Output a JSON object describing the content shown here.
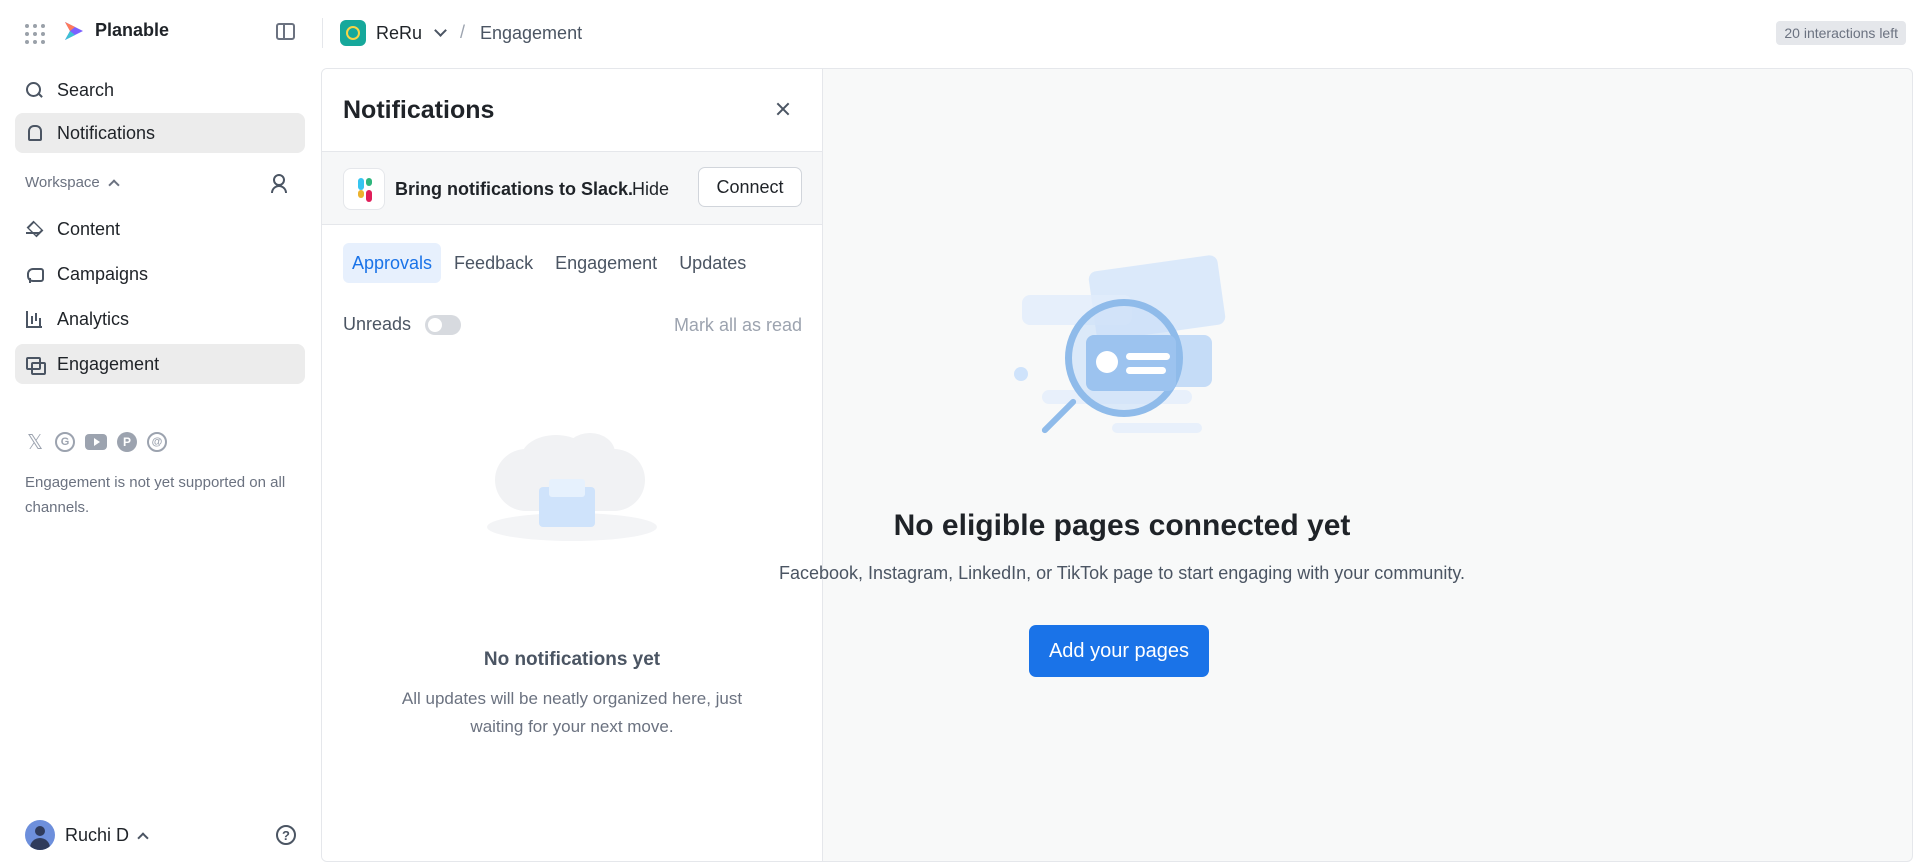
{
  "app": {
    "name": "Planable",
    "workspace_name": "ReRu",
    "breadcrumb_separator": "/",
    "current_page": "Engagement",
    "interactions_badge": "20 interactions left"
  },
  "sidebar": {
    "top_items": [
      {
        "label": "Search",
        "icon": "search-icon"
      },
      {
        "label": "Notifications",
        "icon": "bell-icon"
      }
    ],
    "workspace_label": "Workspace",
    "workspace_items": [
      {
        "label": "Content",
        "icon": "layers-icon"
      },
      {
        "label": "Campaigns",
        "icon": "megaphone-icon"
      },
      {
        "label": "Analytics",
        "icon": "bar-chart-icon"
      },
      {
        "label": "Engagement",
        "icon": "chat-icon"
      }
    ],
    "social_icons": [
      "x-icon",
      "google-business-icon",
      "youtube-icon",
      "pinterest-icon",
      "threads-icon"
    ],
    "engagement_note": "Engagement is not yet supported on all channels.",
    "user_name": "Ruchi D"
  },
  "notifications": {
    "title": "Notifications",
    "slack": {
      "text": "Bring notifications to Slack.",
      "hide_label": "Hide",
      "connect_label": "Connect"
    },
    "tabs": [
      "Approvals",
      "Feedback",
      "Engagement",
      "Updates"
    ],
    "active_tab": "Approvals",
    "unreads_label": "Unreads",
    "unreads_on": false,
    "mark_all_label": "Mark all as read",
    "empty_title": "No notifications yet",
    "empty_desc": "All updates will be neatly organized here, just waiting for your next move."
  },
  "main": {
    "empty_title": "No eligible pages connected yet",
    "empty_desc": "Facebook, Instagram, LinkedIn, or TikTok page to start engaging with your community.",
    "add_button_label": "Add your pages"
  },
  "colors": {
    "accent": "#1a73e8",
    "active_tab_bg": "#e7f0fd",
    "workspace_avatar": "#16a89b"
  }
}
